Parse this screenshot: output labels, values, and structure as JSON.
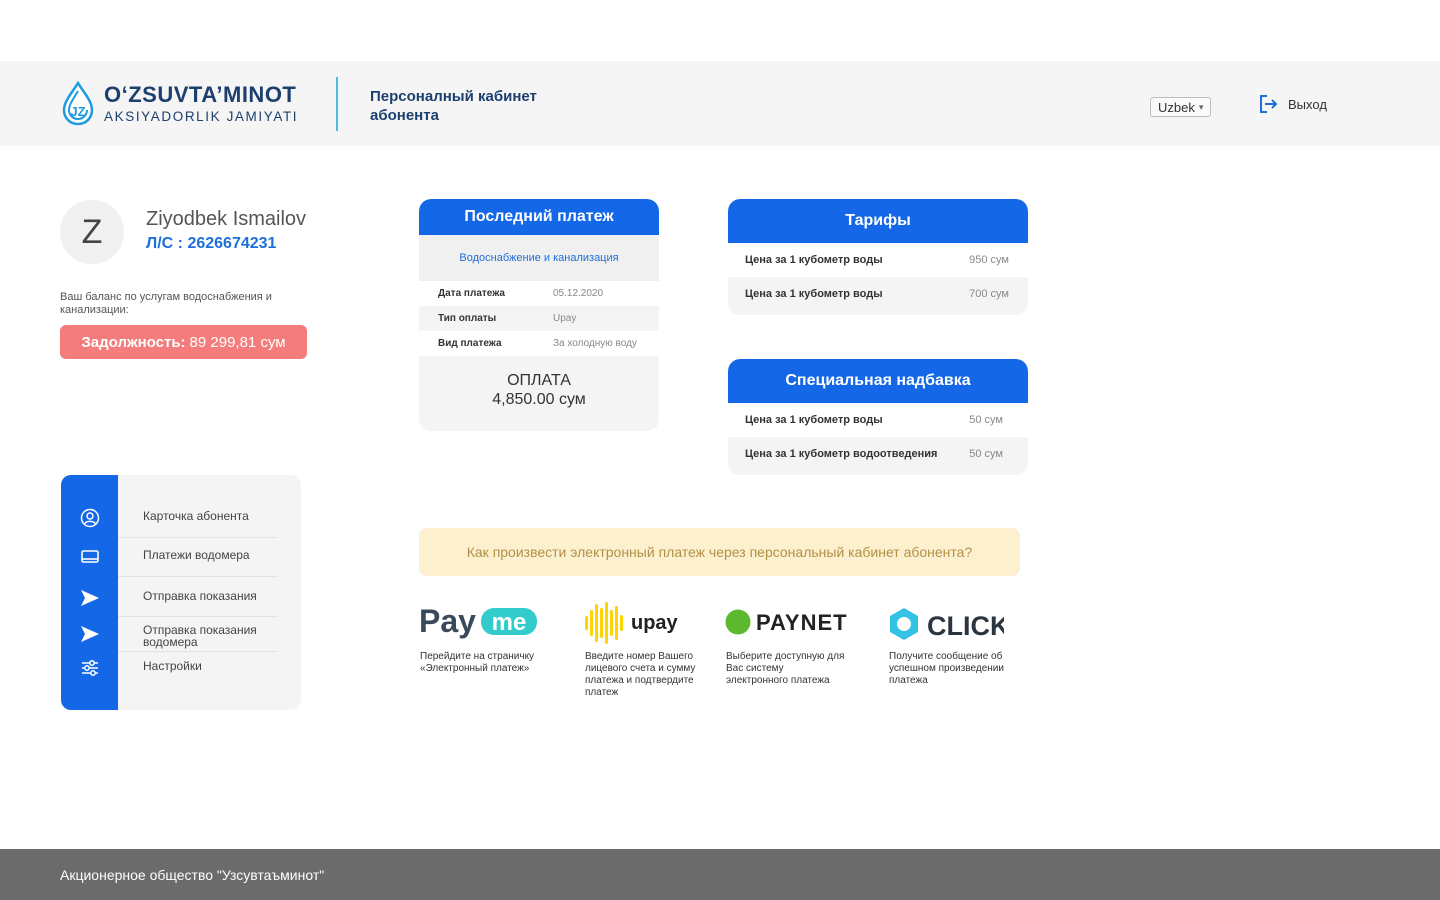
{
  "header": {
    "logo_title": "O‘ZSUVTA’MINOT",
    "logo_subtitle": "AKSIYADORLIK JAMIYATI",
    "title": "Персоналный кабинет абонента",
    "language": "Uzbek",
    "logout_label": "Выход"
  },
  "profile": {
    "avatar_letter": "Z",
    "name": "Ziyodbek Ismailov",
    "account": "Л/С : 2626674231",
    "balance_label": "Ваш баланс по услугам водоснабжения и канализации:",
    "debt_label": "Задолжность:",
    "debt_value": "89 299,81 сум"
  },
  "menu": {
    "items": [
      {
        "label": "Карточка абонента",
        "icon": "user-circle-icon"
      },
      {
        "label": "Платежи водомера",
        "icon": "monitor-icon"
      },
      {
        "label": "Отправка показания",
        "icon": "send-icon"
      },
      {
        "label": "Отправка показания водомера",
        "icon": "send-icon"
      },
      {
        "label": "Настройки",
        "icon": "sliders-icon"
      }
    ]
  },
  "last_payment": {
    "title": "Последний платеж",
    "service": "Водоснабжение и канализация",
    "rows": [
      {
        "key": "Дата платежа",
        "value": "05.12.2020"
      },
      {
        "key": "Тип оплаты",
        "value": "Upay"
      },
      {
        "key": "Вид платежа",
        "value": "За холодную воду"
      }
    ],
    "total_label": "ОПЛАТА",
    "total_value": "4,850.00 сум"
  },
  "tariffs": {
    "title": "Тарифы",
    "rows": [
      {
        "key": "Цена за 1 кубометр воды",
        "value": "950 сум"
      },
      {
        "key": "Цена за 1 кубометр воды",
        "value": "700 сум"
      }
    ]
  },
  "surcharge": {
    "title": "Специальная надбавка",
    "rows": [
      {
        "key": "Цена за 1 кубометр воды",
        "value": "50 сум"
      },
      {
        "key": "Цена за 1 кубометр водоотведения",
        "value": "50 сум"
      }
    ]
  },
  "info_banner": "Как произвести электронный платеж через персональный кабинет абонента?",
  "payment_systems": [
    {
      "name": "Payme",
      "logo_a": "Pay",
      "logo_b": "me",
      "description": "Перейдите на страничку «Электронный платеж»"
    },
    {
      "name": "upay",
      "logo_text": "upay",
      "description": "Введите номер Вашего лицевого счета и сумму платежа и подтвердите платеж"
    },
    {
      "name": "PAYNET",
      "logo_text": "PAYNET",
      "description": "Выберите доступную для Вас систему электронного платежа"
    },
    {
      "name": "CLICK",
      "logo_text": "CLICK",
      "description": "Получите сообщение об успешном произведении платежа"
    }
  ],
  "colors": {
    "primary": "#1468e8",
    "brand_dark": "#1d3f6e",
    "debt": "#f47c7c",
    "banner_bg": "#fdf0cf",
    "banner_text": "#b39047",
    "footer_bg": "#6b6b6b"
  },
  "footer": {
    "text": "Акционерное общество \"Узсувтаъминот\""
  }
}
